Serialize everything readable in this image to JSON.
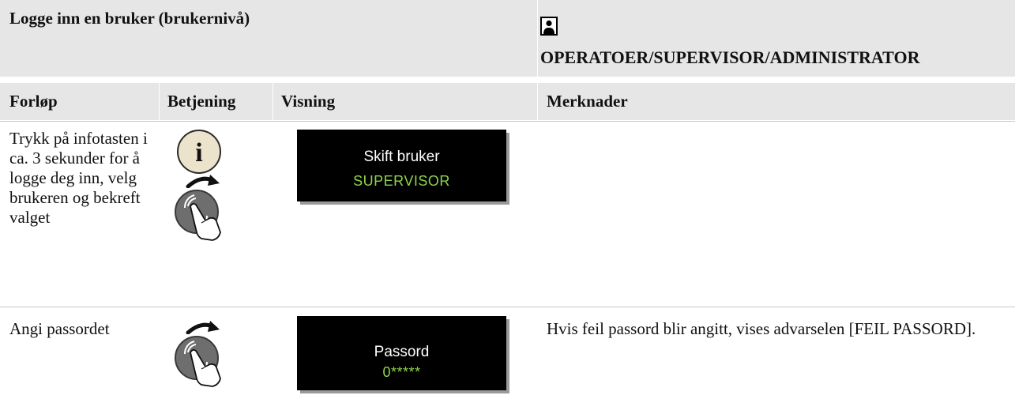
{
  "header": {
    "title": "Logge inn en bruker (brukernivå)",
    "roles": "OPERATOER/SUPERVISOR/ADMINISTRATOR",
    "role_icon": "user-icon"
  },
  "columns": [
    "Forløp",
    "Betjening",
    "Visning",
    "Merknader"
  ],
  "rows": [
    {
      "step": "Trykk på infotasten i ca. 3 sekunder for å logge deg inn, velg brukeren og bekreft valget",
      "controls": [
        "info-key-icon",
        "turn-arrow-icon",
        "rotary-push-knob-icon"
      ],
      "display_line1": "Skift bruker",
      "display_line2": "SUPERVISOR",
      "note": ""
    },
    {
      "step": "Angi passordet",
      "controls": [
        "turn-arrow-icon",
        "rotary-push-knob-icon"
      ],
      "display_line1": "Passord",
      "display_line2": "0*****",
      "note": "Hvis feil passord blir angitt, vises advarselen [FEIL PASSORD]."
    }
  ],
  "colors": {
    "header_bg": "#e6e6e6",
    "display_bg": "#000000",
    "display_value": "#8fd44a",
    "knob": "#6e6e6e",
    "info_key": "#ebe3cc"
  }
}
